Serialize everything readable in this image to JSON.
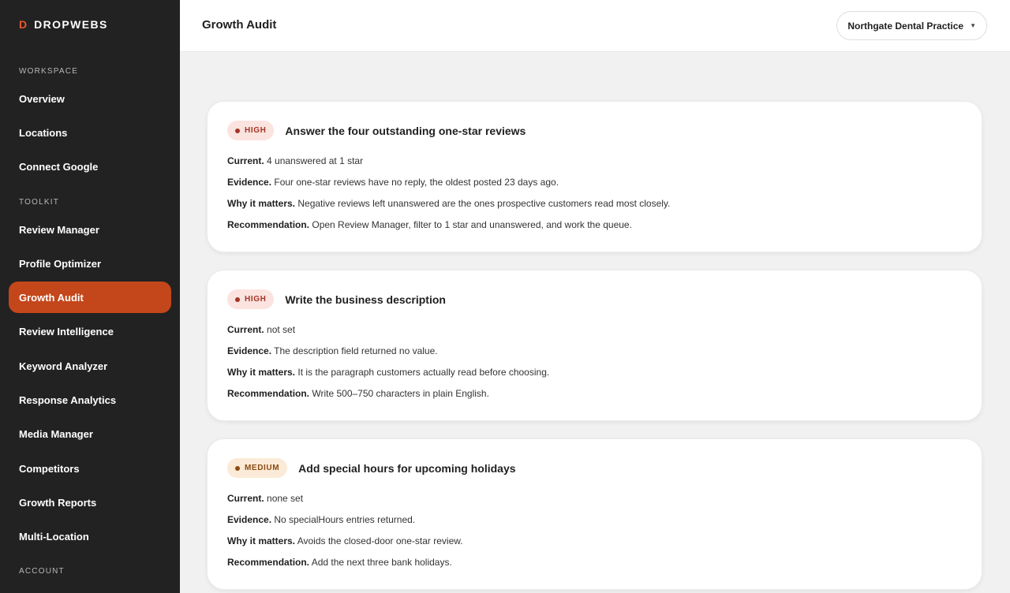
{
  "brand": {
    "mark": "D",
    "name": "DROPWEBS"
  },
  "sidebar": {
    "sections": [
      {
        "label": "WORKSPACE"
      },
      {
        "label": "TOOLKIT"
      },
      {
        "label": "ACCOUNT"
      }
    ],
    "items": [
      {
        "label": "Overview"
      },
      {
        "label": "Locations"
      },
      {
        "label": "Connect Google"
      },
      {
        "label": "Review Manager"
      },
      {
        "label": "Profile Optimizer"
      },
      {
        "label": "Growth Audit",
        "active": true
      },
      {
        "label": "Review Intelligence"
      },
      {
        "label": "Keyword Analyzer"
      },
      {
        "label": "Response Analytics"
      },
      {
        "label": "Media Manager"
      },
      {
        "label": "Competitors"
      },
      {
        "label": "Growth Reports"
      },
      {
        "label": "Multi-Location"
      }
    ]
  },
  "header": {
    "title": "Growth Audit",
    "location_select": {
      "value": "Northgate Dental Practice",
      "caret": "▼"
    }
  },
  "colors": {
    "sidebar_bg": "#222222",
    "accent": "#c4461b",
    "brand_mark": "#e8572b",
    "high_badge_bg": "#fbe3df",
    "high_badge_text": "#a33526",
    "medium_badge_bg": "#fbead7",
    "medium_badge_text": "#8a4b12"
  },
  "field_labels": {
    "current": "Current.",
    "evidence": "Evidence.",
    "why": "Why it matters.",
    "recommendation": "Recommendation."
  },
  "cards": [
    {
      "priority": "HIGH",
      "title": "Answer the four outstanding one-star reviews",
      "current": "4 unanswered at 1 star",
      "evidence": "Four one-star reviews have no reply, the oldest posted 23 days ago.",
      "why": "Negative reviews left unanswered are the ones prospective customers read most closely.",
      "recommendation": "Open Review Manager, filter to 1 star and unanswered, and work the queue."
    },
    {
      "priority": "HIGH",
      "title": "Write the business description",
      "current": "not set",
      "evidence": "The description field returned no value.",
      "why": "It is the paragraph customers actually read before choosing.",
      "recommendation": "Write 500–750 characters in plain English."
    },
    {
      "priority": "MEDIUM",
      "title": "Add special hours for upcoming holidays",
      "current": "none set",
      "evidence": "No specialHours entries returned.",
      "why": "Avoids the closed-door one-star review.",
      "recommendation": "Add the next three bank holidays."
    }
  ]
}
